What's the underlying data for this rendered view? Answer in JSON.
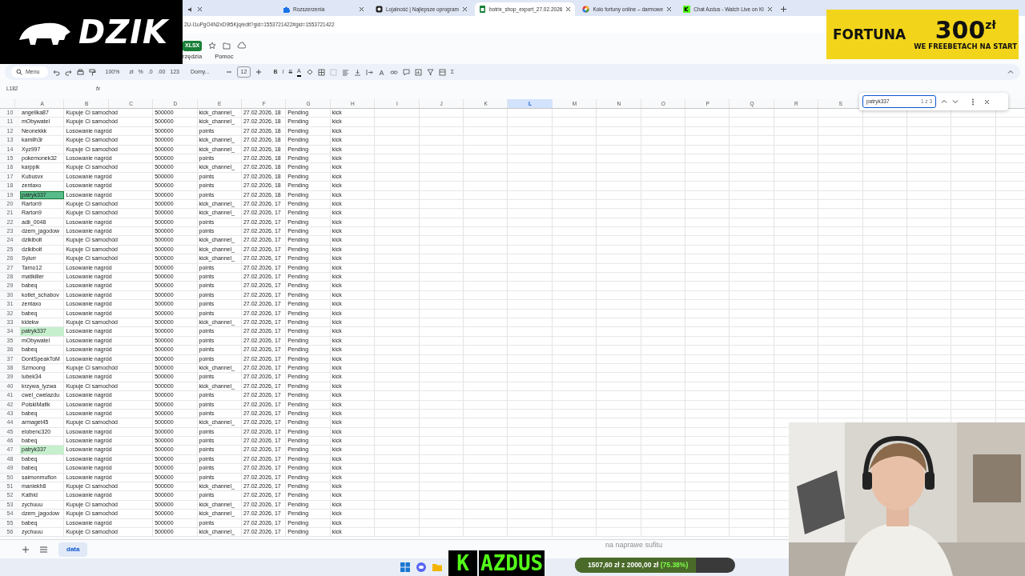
{
  "overlay": {
    "logo": "DZIK",
    "ad": {
      "brand": "FORTUNA",
      "amount": "300",
      "currency": "zł",
      "tagline": "WE FREEBETACH NA START"
    },
    "caption": "na naprawe sufitu",
    "channel": {
      "initial": "K",
      "name": "AZDUS"
    },
    "goal": {
      "text": "1507,60 zł z 2000,00 zł",
      "percent": "(75.38%)",
      "level": 0.7538
    }
  },
  "browser": {
    "tabs": [
      {
        "title": "Rozszerzenia",
        "selected": false
      },
      {
        "title": "Lojalność | Najlepsze oprogram",
        "selected": false
      },
      {
        "title": "botrix_shop_export_27.02.2026",
        "selected": true
      },
      {
        "title": "Koło fortuny online – darmowe",
        "selected": false
      },
      {
        "title": "Chat Azdus - Watch Live on Ki",
        "selected": false
      }
    ],
    "url": "2U-I1uPgO4N2xD9t5Kjq/edit?gid=1553721422#gid=1553721422"
  },
  "doc": {
    "badge": "XLSX",
    "menus": [
      "rzędzia",
      "Pomoc"
    ]
  },
  "toolbar": {
    "search": "Menu",
    "zoom": "100%",
    "currency": "zł",
    "percent": "%",
    "decrease_decimals": ".0",
    "increase_decimals": ".00",
    "format": "123",
    "font": "Domy...",
    "font_size": "12",
    "bold": "B",
    "italic": "I",
    "strike": "S",
    "text_color": "A",
    "function": "Σ"
  },
  "formula_bar": {
    "name_box": "L182",
    "fx": "fx"
  },
  "find": {
    "value": "patryk337",
    "count": "1 z 3"
  },
  "columns": [
    {
      "label": "A",
      "selected": false
    },
    {
      "label": "B",
      "selected": false
    },
    {
      "label": "C",
      "selected": false
    },
    {
      "label": "D",
      "selected": false
    },
    {
      "label": "E",
      "selected": false
    },
    {
      "label": "F",
      "selected": false
    },
    {
      "label": "G",
      "selected": false
    },
    {
      "label": "H",
      "selected": false
    },
    {
      "label": "I",
      "selected": false
    },
    {
      "label": "J",
      "selected": false
    },
    {
      "label": "K",
      "selected": false
    },
    {
      "label": "L",
      "selected": true
    },
    {
      "label": "M",
      "selected": false
    },
    {
      "label": "N",
      "selected": false
    },
    {
      "label": "O",
      "selected": false
    },
    {
      "label": "P",
      "selected": false
    },
    {
      "label": "Q",
      "selected": false
    },
    {
      "label": "R",
      "selected": false
    },
    {
      "label": "S",
      "selected": false
    }
  ],
  "rows": [
    {
      "number": "10",
      "a": "angelika87",
      "b": "Kupuje Ci samochód",
      "d": "500000",
      "e": "kick_channel_",
      "f": "27.02.2026, 18",
      "g": "Pending",
      "h": "kick",
      "found": false,
      "selected": false
    },
    {
      "number": "11",
      "a": "mObywatel",
      "b": "Kupuje Ci samochód",
      "d": "500000",
      "e": "kick_channel_",
      "f": "27.02.2026, 18",
      "g": "Pending",
      "h": "kick",
      "found": false,
      "selected": false
    },
    {
      "number": "12",
      "a": "Neonekkk",
      "b": "Losowanie nagród",
      "d": "500000",
      "e": "points",
      "f": "27.02.2026, 18",
      "g": "Pending",
      "h": "kick",
      "found": false,
      "selected": false
    },
    {
      "number": "13",
      "a": "kamilh3r",
      "b": "Kupuje Ci samochód",
      "d": "500000",
      "e": "kick_channel_",
      "f": "27.02.2026, 18",
      "g": "Pending",
      "h": "kick",
      "found": false,
      "selected": false
    },
    {
      "number": "14",
      "a": "Xyz997",
      "b": "Kupuje Ci samochód",
      "d": "500000",
      "e": "kick_channel_",
      "f": "27.02.2026, 18",
      "g": "Pending",
      "h": "kick",
      "found": false,
      "selected": false
    },
    {
      "number": "15",
      "a": "pokemonek32",
      "b": "Losowanie nagród",
      "d": "500000",
      "e": "points",
      "f": "27.02.2026, 18",
      "g": "Pending",
      "h": "kick",
      "found": false,
      "selected": false
    },
    {
      "number": "16",
      "a": "karppik",
      "b": "Kupuje Ci samochód",
      "d": "500000",
      "e": "kick_channel_",
      "f": "27.02.2026, 18",
      "g": "Pending",
      "h": "kick",
      "found": false,
      "selected": false
    },
    {
      "number": "17",
      "a": "Kubusvx",
      "b": "Losowanie nagród",
      "d": "500000",
      "e": "points",
      "f": "27.02.2026, 18",
      "g": "Pending",
      "h": "kick",
      "found": false,
      "selected": false
    },
    {
      "number": "18",
      "a": "zentaxo",
      "b": "Losowanie nagród",
      "d": "500000",
      "e": "points",
      "f": "27.02.2026, 18",
      "g": "Pending",
      "h": "kick",
      "found": false,
      "selected": false
    },
    {
      "number": "19",
      "a": "patryk337",
      "b": "Losowanie nagród",
      "d": "500000",
      "e": "points",
      "f": "27.02.2026, 18",
      "g": "Pending",
      "h": "kick",
      "found": true,
      "selected": true
    },
    {
      "number": "20",
      "a": "Rarton9",
      "b": "Kupuje Ci samochód",
      "d": "500000",
      "e": "kick_channel_",
      "f": "27.02.2026, 17",
      "g": "Pending",
      "h": "kick",
      "found": false,
      "selected": false
    },
    {
      "number": "21",
      "a": "Rarton9",
      "b": "Kupuje Ci samochód",
      "d": "500000",
      "e": "kick_channel_",
      "f": "27.02.2026, 17",
      "g": "Pending",
      "h": "kick",
      "found": false,
      "selected": false
    },
    {
      "number": "22",
      "a": "adii_0048",
      "b": "Losowanie nagród",
      "d": "500000",
      "e": "points",
      "f": "27.02.2026, 17",
      "g": "Pending",
      "h": "kick",
      "found": false,
      "selected": false
    },
    {
      "number": "23",
      "a": "dzem_jagodow",
      "b": "Losowanie nagród",
      "d": "500000",
      "e": "points",
      "f": "27.02.2026, 17",
      "g": "Pending",
      "h": "kick",
      "found": false,
      "selected": false
    },
    {
      "number": "24",
      "a": "dzikibolt",
      "b": "Kupuje Ci samochód",
      "d": "500000",
      "e": "kick_channel_",
      "f": "27.02.2026, 17",
      "g": "Pending",
      "h": "kick",
      "found": false,
      "selected": false
    },
    {
      "number": "25",
      "a": "dzikibolt",
      "b": "Kupuje Ci samochód",
      "d": "500000",
      "e": "kick_channel_",
      "f": "27.02.2026, 17",
      "g": "Pending",
      "h": "kick",
      "found": false,
      "selected": false
    },
    {
      "number": "26",
      "a": "Sylurr",
      "b": "Kupuje Ci samochód",
      "d": "500000",
      "e": "kick_channel_",
      "f": "27.02.2026, 17",
      "g": "Pending",
      "h": "kick",
      "found": false,
      "selected": false
    },
    {
      "number": "27",
      "a": "Tarno12",
      "b": "Losowanie nagród",
      "d": "500000",
      "e": "points",
      "f": "27.02.2026, 17",
      "g": "Pending",
      "h": "kick",
      "found": false,
      "selected": false
    },
    {
      "number": "28",
      "a": "matikiller",
      "b": "Losowanie nagród",
      "d": "500000",
      "e": "points",
      "f": "27.02.2026, 17",
      "g": "Pending",
      "h": "kick",
      "found": false,
      "selected": false
    },
    {
      "number": "29",
      "a": "babeq",
      "b": "Losowanie nagród",
      "d": "500000",
      "e": "points",
      "f": "27.02.2026, 17",
      "g": "Pending",
      "h": "kick",
      "found": false,
      "selected": false
    },
    {
      "number": "30",
      "a": "kotlet_schabov",
      "b": "Losowanie nagród",
      "d": "500000",
      "e": "points",
      "f": "27.02.2026, 17",
      "g": "Pending",
      "h": "kick",
      "found": false,
      "selected": false
    },
    {
      "number": "31",
      "a": "zentaxo",
      "b": "Losowanie nagród",
      "d": "500000",
      "e": "points",
      "f": "27.02.2026, 17",
      "g": "Pending",
      "h": "kick",
      "found": false,
      "selected": false
    },
    {
      "number": "32",
      "a": "babeq",
      "b": "Losowanie nagród",
      "d": "500000",
      "e": "points",
      "f": "27.02.2026, 17",
      "g": "Pending",
      "h": "kick",
      "found": false,
      "selected": false
    },
    {
      "number": "33",
      "a": "kidekw",
      "b": "Kupuje Ci samochód",
      "d": "500000",
      "e": "kick_channel_",
      "f": "27.02.2026, 17",
      "g": "Pending",
      "h": "kick",
      "found": false,
      "selected": false
    },
    {
      "number": "34",
      "a": "patryk337",
      "b": "Losowanie nagród",
      "d": "500000",
      "e": "points",
      "f": "27.02.2026, 17",
      "g": "Pending",
      "h": "kick",
      "found": true,
      "selected": false
    },
    {
      "number": "35",
      "a": "mObywatel",
      "b": "Losowanie nagród",
      "d": "500000",
      "e": "points",
      "f": "27.02.2026, 17",
      "g": "Pending",
      "h": "kick",
      "found": false,
      "selected": false
    },
    {
      "number": "36",
      "a": "babeq",
      "b": "Losowanie nagród",
      "d": "500000",
      "e": "points",
      "f": "27.02.2026, 17",
      "g": "Pending",
      "h": "kick",
      "found": false,
      "selected": false
    },
    {
      "number": "37",
      "a": "DontSpeakToM",
      "b": "Losowanie nagród",
      "d": "500000",
      "e": "points",
      "f": "27.02.2026, 17",
      "g": "Pending",
      "h": "kick",
      "found": false,
      "selected": false
    },
    {
      "number": "38",
      "a": "Szmoong",
      "b": "Kupuje Ci samochód",
      "d": "500000",
      "e": "kick_channel_",
      "f": "27.02.2026, 17",
      "g": "Pending",
      "h": "kick",
      "found": false,
      "selected": false
    },
    {
      "number": "39",
      "a": "lubek34",
      "b": "Losowanie nagród",
      "d": "500000",
      "e": "points",
      "f": "27.02.2026, 17",
      "g": "Pending",
      "h": "kick",
      "found": false,
      "selected": false
    },
    {
      "number": "40",
      "a": "krzywa_lyzwa",
      "b": "Kupuje Ci samochód",
      "d": "500000",
      "e": "kick_channel_",
      "f": "27.02.2026, 17",
      "g": "Pending",
      "h": "kick",
      "found": false,
      "selected": false
    },
    {
      "number": "41",
      "a": "cwel_cwelazdu",
      "b": "Losowanie nagród",
      "d": "500000",
      "e": "points",
      "f": "27.02.2026, 17",
      "g": "Pending",
      "h": "kick",
      "found": false,
      "selected": false
    },
    {
      "number": "42",
      "a": "PolskiMafik",
      "b": "Losowanie nagród",
      "d": "500000",
      "e": "points",
      "f": "27.02.2026, 17",
      "g": "Pending",
      "h": "kick",
      "found": false,
      "selected": false
    },
    {
      "number": "43",
      "a": "babeq",
      "b": "Losowanie nagród",
      "d": "500000",
      "e": "points",
      "f": "27.02.2026, 17",
      "g": "Pending",
      "h": "kick",
      "found": false,
      "selected": false
    },
    {
      "number": "44",
      "a": "armaget45",
      "b": "Kupuje Ci samochód",
      "d": "500000",
      "e": "kick_channel_",
      "f": "27.02.2026, 17",
      "g": "Pending",
      "h": "kick",
      "found": false,
      "selected": false
    },
    {
      "number": "45",
      "a": "elobenc320",
      "b": "Losowanie nagród",
      "d": "500000",
      "e": "points",
      "f": "27.02.2026, 17",
      "g": "Pending",
      "h": "kick",
      "found": false,
      "selected": false
    },
    {
      "number": "46",
      "a": "babeq",
      "b": "Losowanie nagród",
      "d": "500000",
      "e": "points",
      "f": "27.02.2026, 17",
      "g": "Pending",
      "h": "kick",
      "found": false,
      "selected": false
    },
    {
      "number": "47",
      "a": "patryk337",
      "b": "Losowanie nagród",
      "d": "500000",
      "e": "points",
      "f": "27.02.2026, 17",
      "g": "Pending",
      "h": "kick",
      "found": true,
      "selected": false
    },
    {
      "number": "48",
      "a": "babeq",
      "b": "Losowanie nagród",
      "d": "500000",
      "e": "points",
      "f": "27.02.2026, 17",
      "g": "Pending",
      "h": "kick",
      "found": false,
      "selected": false
    },
    {
      "number": "49",
      "a": "babeq",
      "b": "Losowanie nagród",
      "d": "500000",
      "e": "points",
      "f": "27.02.2026, 17",
      "g": "Pending",
      "h": "kick",
      "found": false,
      "selected": false
    },
    {
      "number": "50",
      "a": "saimonmuflon",
      "b": "Losowanie nagród",
      "d": "500000",
      "e": "points",
      "f": "27.02.2026, 17",
      "g": "Pending",
      "h": "kick",
      "found": false,
      "selected": false
    },
    {
      "number": "51",
      "a": "maniekh8",
      "b": "Kupuje Ci samochód",
      "d": "500000",
      "e": "kick_channel_",
      "f": "27.02.2026, 17",
      "g": "Pending",
      "h": "kick",
      "found": false,
      "selected": false
    },
    {
      "number": "52",
      "a": "Kathid",
      "b": "Losowanie nagród",
      "d": "500000",
      "e": "points",
      "f": "27.02.2026, 17",
      "g": "Pending",
      "h": "kick",
      "found": false,
      "selected": false
    },
    {
      "number": "53",
      "a": "zychuuu",
      "b": "Kupuje Ci samochód",
      "d": "500000",
      "e": "kick_channel_",
      "f": "27.02.2026, 17",
      "g": "Pending",
      "h": "kick",
      "found": false,
      "selected": false
    },
    {
      "number": "54",
      "a": "dzem_jagodow",
      "b": "Kupuje Ci samochód",
      "d": "500000",
      "e": "kick_channel_",
      "f": "27.02.2026, 17",
      "g": "Pending",
      "h": "kick",
      "found": false,
      "selected": false
    },
    {
      "number": "55",
      "a": "babeq",
      "b": "Losowanie nagród",
      "d": "500000",
      "e": "points",
      "f": "27.02.2026, 17",
      "g": "Pending",
      "h": "kick",
      "found": false,
      "selected": false
    },
    {
      "number": "56",
      "a": "zychuuu",
      "b": "Kupuje Ci samochód",
      "d": "500000",
      "e": "kick_channel_",
      "f": "27.02.2026, 17",
      "g": "Pending",
      "h": "kick",
      "found": false,
      "selected": false
    }
  ],
  "sheets": [
    {
      "label": "data",
      "selected": true
    }
  ]
}
